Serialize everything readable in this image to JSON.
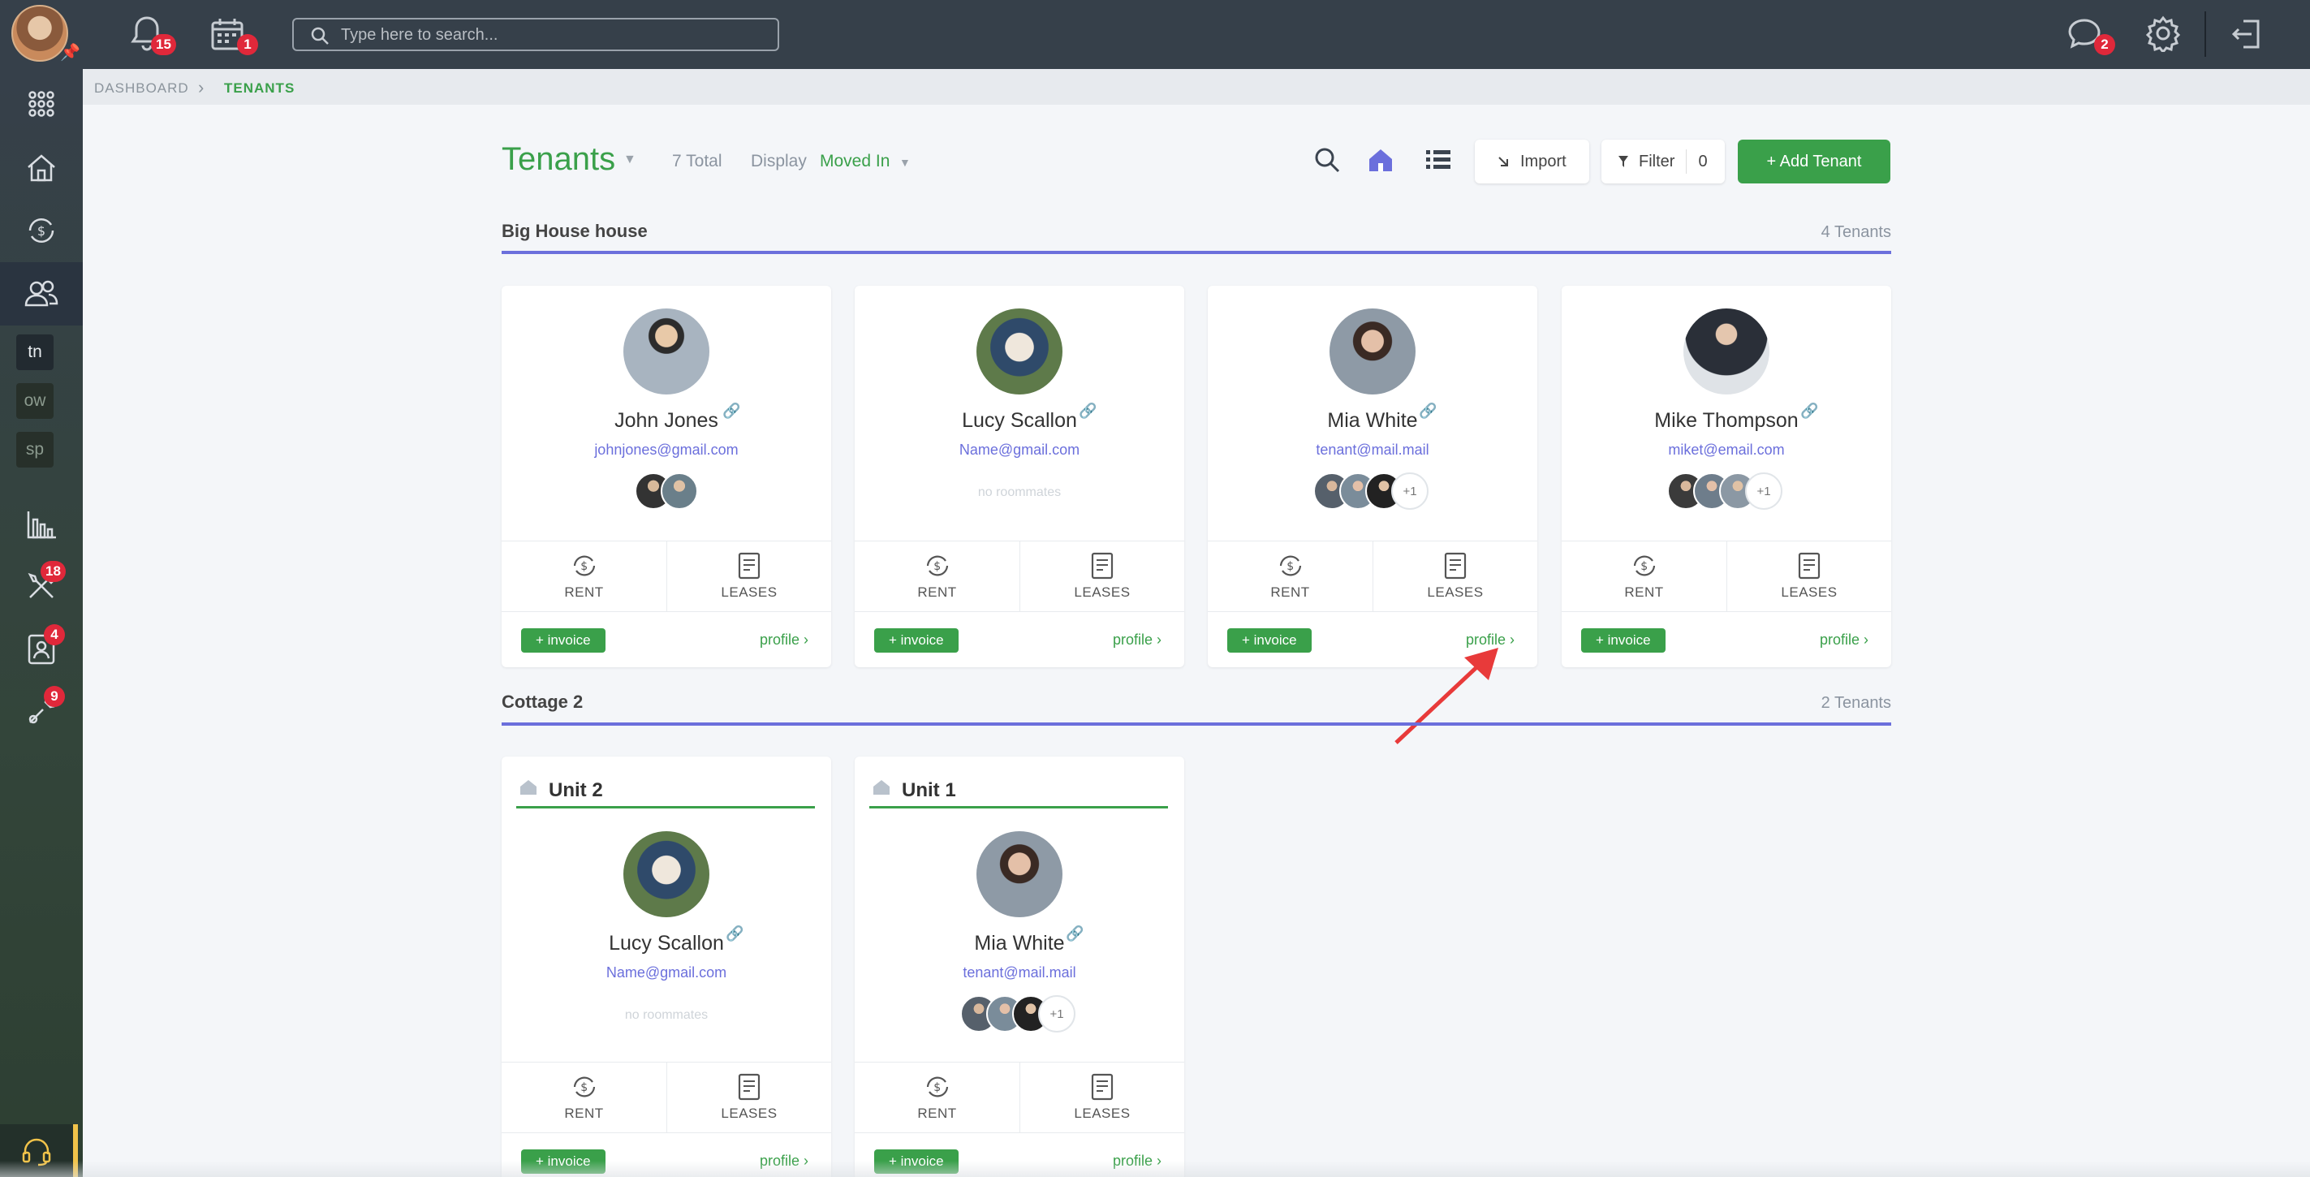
{
  "topbar": {
    "notifications_count": "15",
    "calendar_count": "1",
    "search_placeholder": "Type here to search...",
    "messages_count": "2"
  },
  "sidebar": {
    "tags": [
      "tn",
      "ow",
      "sp"
    ],
    "badges": {
      "maintenance": "18",
      "contacts": "4",
      "tools": "9"
    }
  },
  "breadcrumb": {
    "root": "DASHBOARD",
    "current": "TENANTS"
  },
  "header": {
    "title": "Tenants",
    "total": "7 Total",
    "display_label": "Display",
    "display_value": "Moved In",
    "import_label": "Import",
    "filter_label": "Filter",
    "filter_count": "0",
    "add_label": "+ Add Tenant"
  },
  "groups": [
    {
      "title": "Big House house",
      "count": "4 Tenants",
      "cards": [
        {
          "name": "John Jones",
          "email": "johnjones@gmail.com",
          "roommates": [
            "",
            ""
          ],
          "plus": ""
        },
        {
          "name": "Lucy Scallon",
          "email": "Name@gmail.com",
          "noroom": "no roommates"
        },
        {
          "name": "Mia White",
          "email": "tenant@mail.mail",
          "plus": "+1"
        },
        {
          "name": "Mike Thompson",
          "email": "miket@email.com",
          "plus": "+1"
        }
      ]
    },
    {
      "title": "Cottage 2",
      "count": "2 Tenants",
      "cards": [
        {
          "unit": "Unit 2",
          "name": "Lucy Scallon",
          "email": "Name@gmail.com",
          "noroom": "no roommates"
        },
        {
          "unit": "Unit 1",
          "name": "Mia White",
          "email": "tenant@mail.mail",
          "plus": "+1"
        }
      ]
    }
  ],
  "card_labels": {
    "rent": "RENT",
    "leases": "LEASES",
    "invoice": "+ invoice",
    "profile": "profile ›"
  },
  "colors": {
    "accent_green": "#3aa04a",
    "accent_purple": "#6b6fdc",
    "topbar": "#36404a",
    "badge_red": "#e0283a"
  }
}
